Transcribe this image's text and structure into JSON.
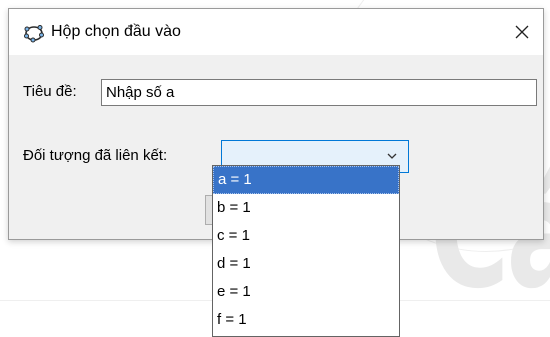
{
  "dialog": {
    "title": "Hộp chọn đầu vào",
    "close_label": "✕",
    "caption_label": "Tiêu đề:",
    "caption_value": "Nhập số a",
    "linked_object_label": "Đối tượng đã liên kết:",
    "linked_object_value": "",
    "options": [
      {
        "label": "a = 1",
        "selected": true
      },
      {
        "label": "b = 1",
        "selected": false
      },
      {
        "label": "c = 1",
        "selected": false
      },
      {
        "label": "d = 1",
        "selected": false
      },
      {
        "label": "e = 1",
        "selected": false
      },
      {
        "label": "f = 1",
        "selected": false
      }
    ]
  },
  "background": {
    "watermark_text": "Cá"
  },
  "colors": {
    "dialog_bg": "#f0f0f0",
    "combo_focus": "#0078d7",
    "selection": "#3873c8",
    "icon_stroke": "#2b2b2b"
  }
}
